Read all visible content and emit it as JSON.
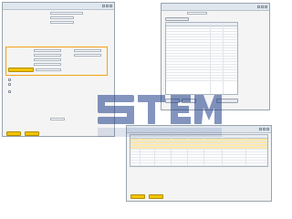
{
  "colors": {
    "window_bg": "#f4f4f4",
    "titlebar": "#dfe6ee",
    "accent_yellow": "#f3c300",
    "highlight_orange": "#f5a21a",
    "watermark_blue": "#1f3f8a",
    "row_highlight": "#ffe9a8"
  },
  "icons": {
    "window_controls": [
      "minimize-icon",
      "maximize-icon",
      "close-icon"
    ],
    "watermark": "stem-logo-watermark"
  },
  "window_left": {
    "title": "",
    "fields": [],
    "buttons": []
  },
  "window_right_top": {
    "title": "",
    "rows": []
  },
  "window_right_bottom": {
    "title": "",
    "rows": []
  },
  "watermark": {
    "text": "",
    "subtext": ""
  }
}
